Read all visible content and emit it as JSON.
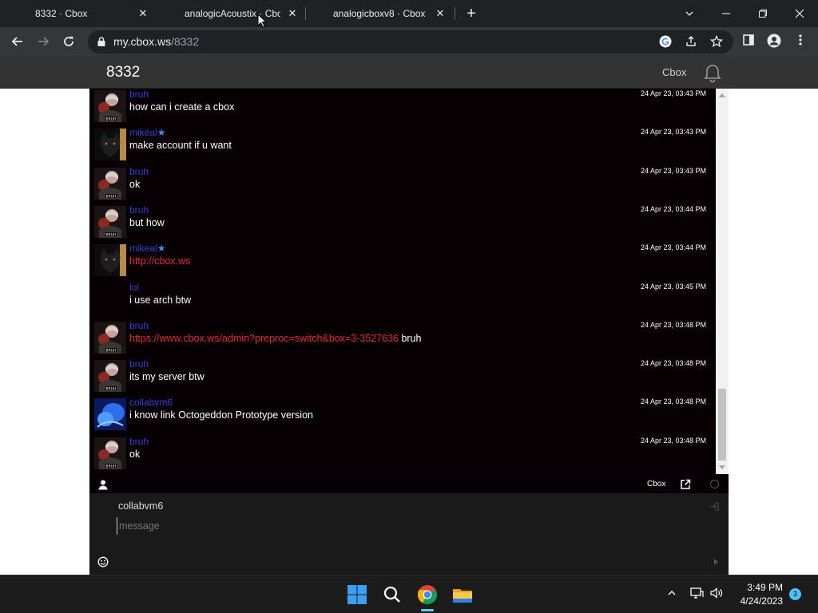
{
  "browser": {
    "tabs": [
      {
        "title": "8332 · Cbox",
        "active": true
      },
      {
        "title": "analogicAcoustix · Cbox",
        "active": false
      },
      {
        "title": "analogicboxv8 · Cbox",
        "active": false
      }
    ],
    "url_host": "my.cbox.ws",
    "url_path": "/8332"
  },
  "site": {
    "title": "8332",
    "brand": "Cbox"
  },
  "messages": [
    {
      "user": "bruh",
      "star": false,
      "avatar": "bruh-avatar",
      "time": "24 Apr 23, 03:43 PM",
      "text": "how can i create a cbox",
      "link": "",
      "suffix": ""
    },
    {
      "user": "mikeal",
      "star": true,
      "avatar": "cat-avatar",
      "time": "24 Apr 23, 03:43 PM",
      "text": "make account if u want",
      "link": "",
      "suffix": ""
    },
    {
      "user": "bruh",
      "star": false,
      "avatar": "bruh-avatar",
      "time": "24 Apr 23, 03:43 PM",
      "text": "ok",
      "link": "",
      "suffix": ""
    },
    {
      "user": "bruh",
      "star": false,
      "avatar": "bruh-avatar",
      "time": "24 Apr 23, 03:44 PM",
      "text": "but how",
      "link": "",
      "suffix": ""
    },
    {
      "user": "mikeal",
      "star": true,
      "avatar": "cat-avatar",
      "time": "24 Apr 23, 03:44 PM",
      "text": "",
      "link": "http://cbox.ws",
      "suffix": ""
    },
    {
      "user": "lol",
      "star": false,
      "avatar": "none",
      "time": "24 Apr 23, 03:45 PM",
      "text": "i use arch btw",
      "link": "",
      "suffix": ""
    },
    {
      "user": "bruh",
      "star": false,
      "avatar": "bruh-avatar",
      "time": "24 Apr 23, 03:48 PM",
      "text": "",
      "link": "https://www.cbox.ws/admin?preproc=switch&box=3-3527636",
      "suffix": " bruh"
    },
    {
      "user": "bruh",
      "star": false,
      "avatar": "bruh-avatar",
      "time": "24 Apr 23, 03:48 PM",
      "text": "its my server btw",
      "link": "",
      "suffix": ""
    },
    {
      "user": "collabvm6",
      "star": false,
      "avatar": "blue-avatar",
      "time": "24 Apr 23, 03:48 PM",
      "text": "i know link Octogeddon Prototype version",
      "link": "",
      "suffix": ""
    },
    {
      "user": "bruh",
      "star": false,
      "avatar": "bruh-avatar",
      "time": "24 Apr 23, 03:48 PM",
      "text": "ok",
      "link": "",
      "suffix": ""
    }
  ],
  "statusbar": {
    "brand": "Cbox"
  },
  "compose": {
    "name": "collabvm6",
    "placeholder": "message",
    "value": ""
  },
  "taskbar": {
    "time": "3:49 PM",
    "date": "4/24/2023",
    "notifications": "3"
  },
  "colors": {
    "username": "#3b3bd6",
    "link": "#e0282f",
    "star": "#3e8ee6"
  }
}
